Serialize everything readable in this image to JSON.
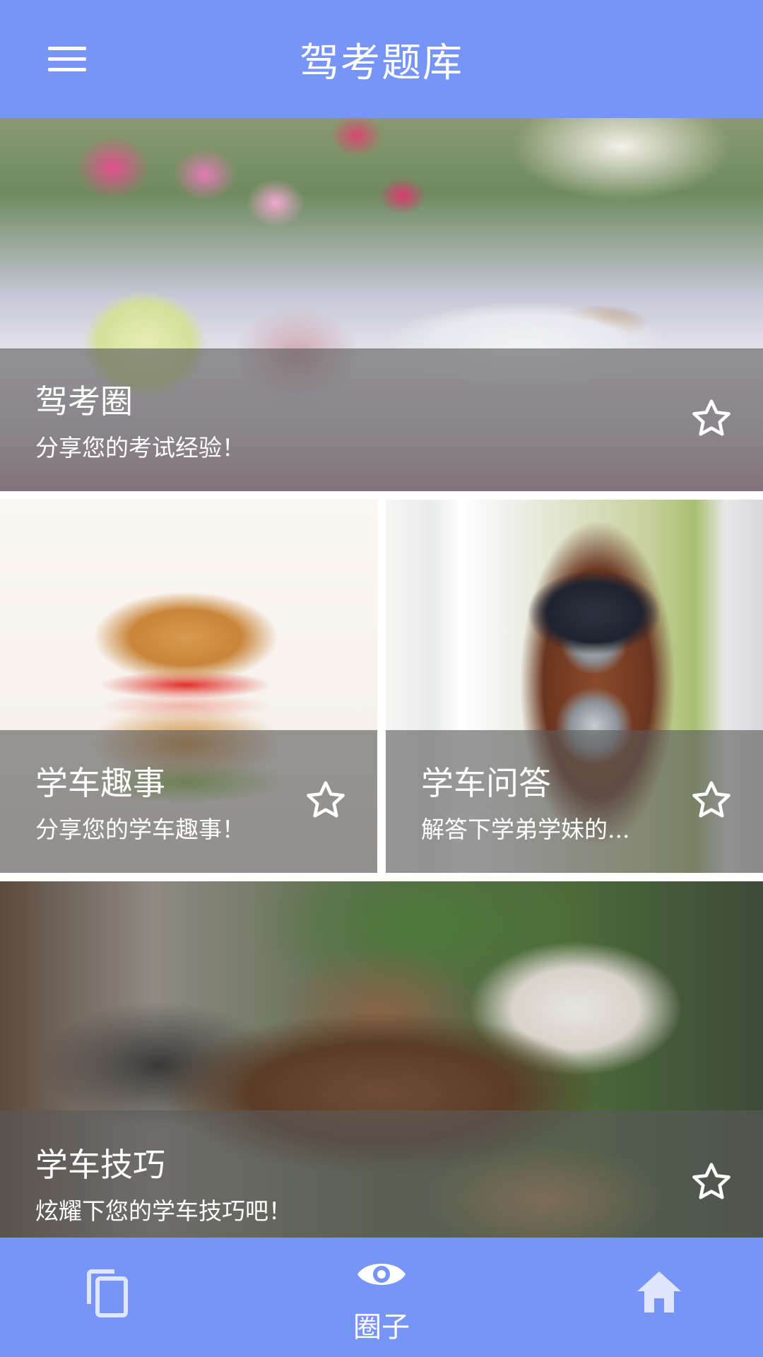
{
  "header": {
    "title": "驾考题库"
  },
  "cards": [
    {
      "title": "驾考圈",
      "subtitle": "分享您的考试经验！"
    },
    {
      "title": "学车趣事",
      "subtitle": "分享您的学车趣事！"
    },
    {
      "title": "学车问答",
      "subtitle": "解答下学弟学妹的..."
    },
    {
      "title": "学车技巧",
      "subtitle": "炫耀下您的学车技巧吧！"
    }
  ],
  "bottom_nav": {
    "items": [
      {
        "label": "",
        "icon": "copy-icon"
      },
      {
        "label": "圈子",
        "icon": "eye-icon"
      },
      {
        "label": "",
        "icon": "home-icon"
      }
    ]
  },
  "colors": {
    "primary": "#7795f8",
    "overlay": "rgba(90,90,90,0.62)",
    "text": "#ffffff"
  }
}
